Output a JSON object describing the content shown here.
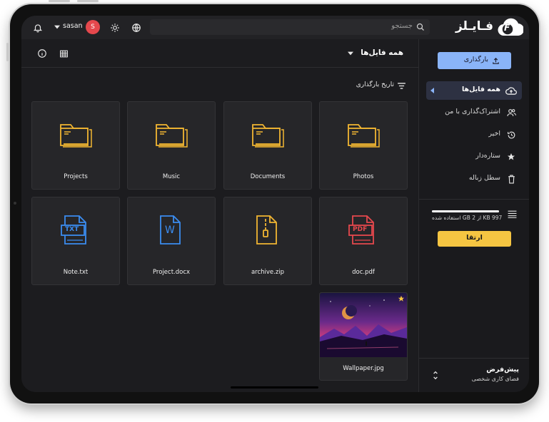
{
  "app": {
    "logo_text": "فـایـلز",
    "logo_letter": "F"
  },
  "topbar": {
    "search_placeholder": "جستجو",
    "user_name": "sasan",
    "user_initial": "S"
  },
  "toolbar": {
    "current_folder": "همه فایل‌ها",
    "sort_label": "تاریخ بارگذاری"
  },
  "sidebar": {
    "upload_label": "بارگذاری",
    "items": [
      {
        "label": "همه فایل‌ها",
        "icon": "cloud-upload-icon",
        "active": true
      },
      {
        "label": "اشتراک‌گذاری با من",
        "icon": "people-icon",
        "active": false
      },
      {
        "label": "اخیر",
        "icon": "history-icon",
        "active": false
      },
      {
        "label": "ستاره‌دار",
        "icon": "star-icon",
        "active": false
      },
      {
        "label": "سطل زباله",
        "icon": "trash-icon",
        "active": false
      }
    ],
    "storage_text": "997 KB از 2 GB استفاده شده",
    "storage_used_fraction": 0.0005,
    "upgrade_label": "ارتقا",
    "workspace_name": "پیش‌فرض",
    "workspace_sub": "فضای کاری شخصی"
  },
  "files": [
    {
      "name": "Photos",
      "type": "folder"
    },
    {
      "name": "Documents",
      "type": "folder"
    },
    {
      "name": "Music",
      "type": "folder"
    },
    {
      "name": "Projects",
      "type": "folder"
    },
    {
      "name": "doc.pdf",
      "type": "pdf",
      "badge": "PDF"
    },
    {
      "name": "archive.zip",
      "type": "zip"
    },
    {
      "name": "Project.docx",
      "type": "docx",
      "badge": "W"
    },
    {
      "name": "Note.txt",
      "type": "txt",
      "badge": "TXT"
    },
    {
      "name": "Wallpaper.jpg",
      "type": "image",
      "starred": true
    }
  ],
  "colors": {
    "accent_blue": "#8ab4f8",
    "upgrade_yellow": "#f5c542",
    "avatar_red": "#e5484d",
    "folder_yellow": "#f2b632",
    "pdf_red": "#e5484d",
    "doc_blue": "#3b8cf0"
  }
}
